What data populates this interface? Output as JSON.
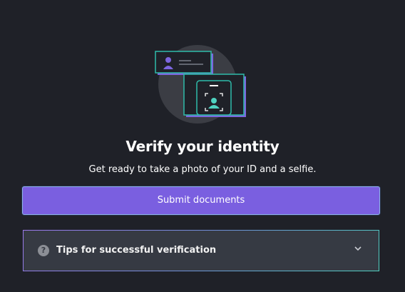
{
  "verification": {
    "title": "Verify your identity",
    "subtitle": "Get ready to take a photo of your ID and a selfie.",
    "submit_label": "Submit documents",
    "tips_label": "Tips for successful verification"
  },
  "icons": {
    "illustration": "id-card-selfie-illustration",
    "tips": "question-circle-icon",
    "expand": "chevron-down-icon"
  },
  "colors": {
    "background": "#1f2128",
    "accent": "#7a5fe0",
    "teal": "#4fd2c0",
    "panel": "#363a43"
  }
}
